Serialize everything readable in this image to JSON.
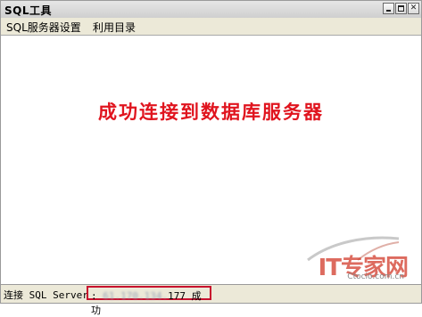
{
  "window": {
    "title": "SQL工具",
    "controls": [
      "minimize-icon",
      "maximize-icon",
      "close-icon"
    ]
  },
  "menu": {
    "items": [
      {
        "label": "SQL服务器设置"
      },
      {
        "label": "利用目录"
      }
    ]
  },
  "main": {
    "message": "成功连接到数据库服务器",
    "message_color": "#e0141e"
  },
  "status": {
    "label": "连接 SQL Server",
    "value_prefix": ": ",
    "value_ip_obscured": "61.170.134.",
    "value_ip_tail": "177",
    "value_suffix": " 成功",
    "highlight_color": "#c8102e"
  },
  "watermark": {
    "logo": "IT专家网",
    "url": "Ctocio.com.cn"
  }
}
